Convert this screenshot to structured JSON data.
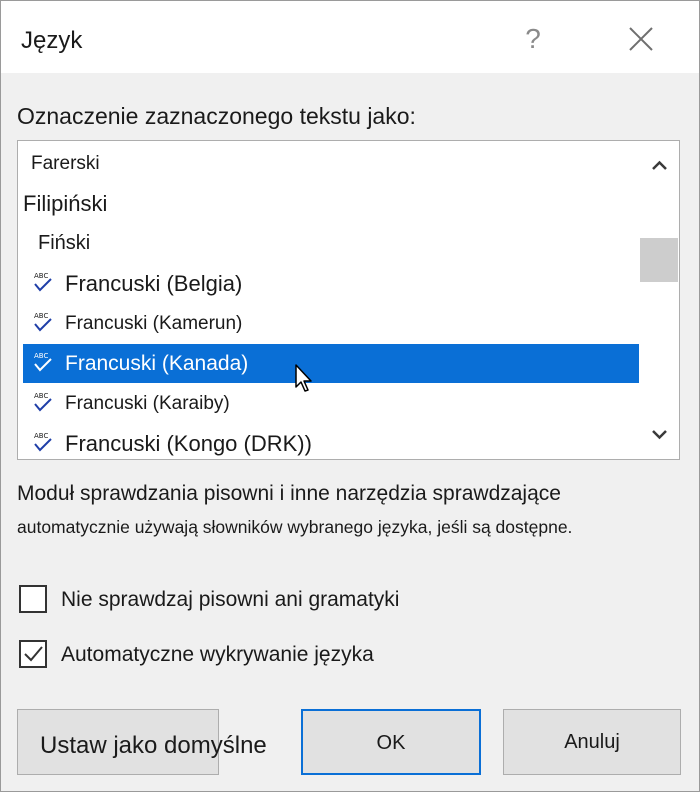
{
  "dialog": {
    "title": "Język",
    "help_glyph": "?"
  },
  "language_list": {
    "label": "Oznaczenie zaznaczonego tekstu jako:",
    "items": [
      {
        "label": "Farerski",
        "spellcheck": false,
        "selected": false
      },
      {
        "label": "Filipiński",
        "spellcheck": false,
        "selected": false
      },
      {
        "label": "Fiński",
        "spellcheck": false,
        "selected": false
      },
      {
        "label": "Francuski (Belgia)",
        "spellcheck": true,
        "selected": false
      },
      {
        "label": "Francuski (Kamerun)",
        "spellcheck": true,
        "selected": false
      },
      {
        "label": "Francuski (Kanada)",
        "spellcheck": true,
        "selected": true
      },
      {
        "label": "Francuski (Karaiby)",
        "spellcheck": true,
        "selected": false
      },
      {
        "label": "Francuski (Kongo (DRK))",
        "spellcheck": true,
        "selected": false
      }
    ]
  },
  "description": {
    "line1": "Moduł sprawdzania pisowni i inne narzędzia sprawdzające",
    "line2": "automatycznie używają słowników wybranego języka, jeśli są dostępne."
  },
  "options": {
    "no_proofing": {
      "label": "Nie sprawdzaj pisowni ani gramatyki",
      "checked": false
    },
    "auto_detect": {
      "label": "Automatyczne wykrywanie języka",
      "checked": true
    }
  },
  "buttons": {
    "set_default": "Ustaw jako domyślne",
    "ok": "OK",
    "cancel": "Anuluj"
  },
  "icons": {
    "help": "help-icon",
    "close": "close-icon",
    "spellcheck": "abc-check-icon",
    "scroll_up": "chevron-up-icon",
    "scroll_down": "chevron-down-icon",
    "cursor": "mouse-pointer-icon"
  },
  "colors": {
    "selection": "#0a6fd6",
    "dialog_bg": "#f0f0f0",
    "default_button_border": "#0a6fd6"
  }
}
